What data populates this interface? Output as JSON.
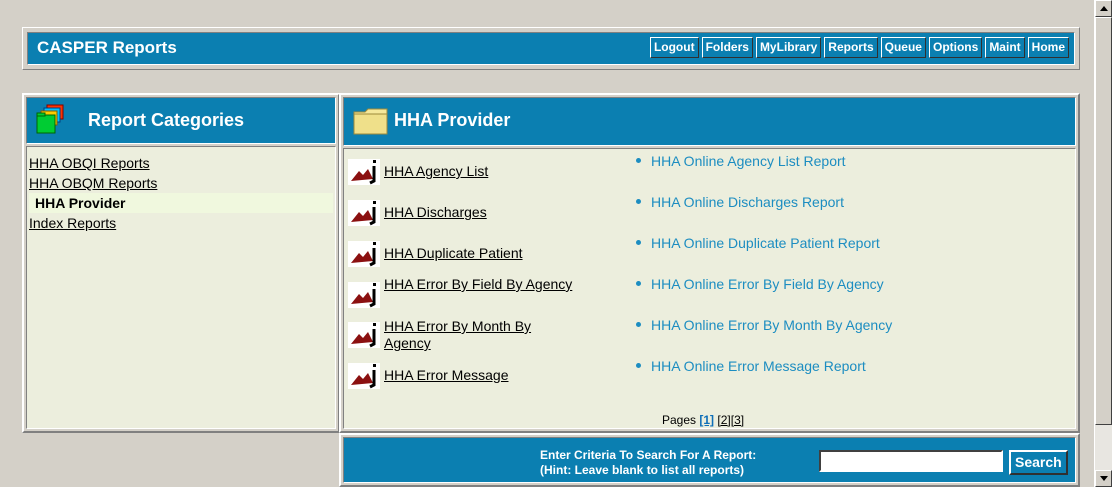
{
  "header": {
    "title": "CASPER Reports",
    "nav": [
      "Logout",
      "Folders",
      "MyLibrary",
      "Reports",
      "Queue",
      "Options",
      "Maint",
      "Home"
    ]
  },
  "categories": {
    "title": "Report Categories",
    "items": [
      {
        "label": "HHA OBQI Reports",
        "selected": false
      },
      {
        "label": "HHA OBQM Reports",
        "selected": false
      },
      {
        "label": "HHA Provider",
        "selected": true
      },
      {
        "label": "Index Reports",
        "selected": false
      }
    ]
  },
  "main": {
    "title": "HHA Provider",
    "reports": [
      {
        "label": "HHA Agency List",
        "online": "HHA Online Agency List Report"
      },
      {
        "label": "HHA Discharges",
        "online": "HHA Online Discharges Report"
      },
      {
        "label": "HHA Duplicate Patient",
        "online": "HHA Online Duplicate Patient Report"
      },
      {
        "label": "HHA Error By Field By Agency",
        "online": "HHA Online Error By Field By Agency"
      },
      {
        "label": "HHA Error By Month By Agency",
        "online": "HHA Online Error By Month By Agency"
      },
      {
        "label": "HHA Error Message",
        "online": "HHA Online Error Message Report"
      }
    ],
    "pages": {
      "label": "Pages",
      "current": "[1]",
      "others": [
        "[2]",
        "[3]"
      ]
    }
  },
  "search": {
    "line1": "Enter Criteria To Search For A Report:",
    "line2": "(Hint: Leave blank to list all reports)",
    "value": "",
    "button": "Search"
  },
  "colors": {
    "header_bg": "#0b7fb1",
    "panel_bg": "#eceedd",
    "link_blue": "#1c8dc1"
  }
}
